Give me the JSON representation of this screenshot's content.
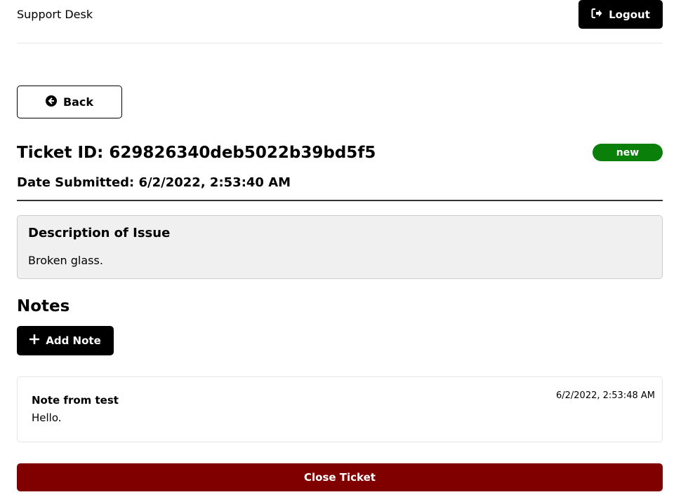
{
  "header": {
    "brand": "Support Desk",
    "logout_label": "Logout",
    "logout_icon": "sign-out-icon"
  },
  "back_button": {
    "label": "Back",
    "icon": "arrow-circle-left-icon"
  },
  "ticket": {
    "title": "Ticket ID: 629826340deb5022b39bd5f5",
    "status": "new",
    "status_color": "#0a7f0a",
    "date_submitted": "Date Submitted: 6/2/2022, 2:53:40 AM"
  },
  "description": {
    "heading": "Description of Issue",
    "text": "Broken glass."
  },
  "notes": {
    "heading": "Notes",
    "add_label": "Add Note",
    "add_icon": "plus-icon",
    "items": [
      {
        "author": "Note from test",
        "date": "6/2/2022, 2:53:48 AM",
        "text": "Hello."
      }
    ]
  },
  "close_button": {
    "label": "Close Ticket",
    "color": "#800000"
  }
}
